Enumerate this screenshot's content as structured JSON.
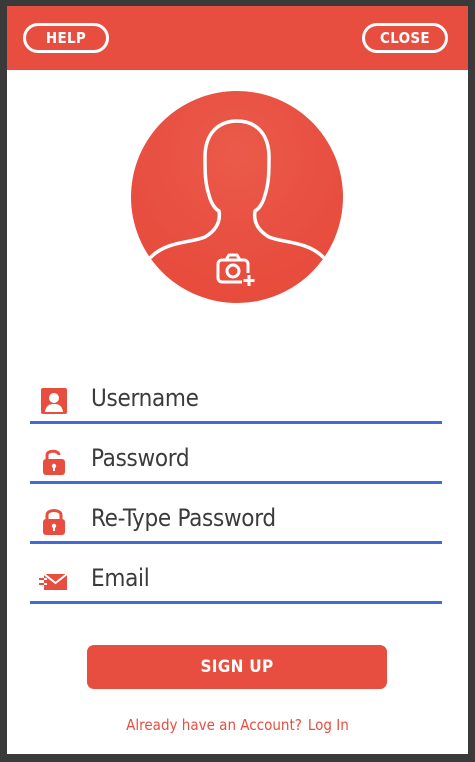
{
  "header": {
    "help_label": "HELP",
    "close_label": "CLOSE"
  },
  "avatar": {
    "icon": "person-silhouette-icon",
    "camera_icon": "camera-add-icon"
  },
  "form": {
    "fields": [
      {
        "icon": "user-icon",
        "placeholder": "Username"
      },
      {
        "icon": "unlock-icon",
        "placeholder": "Password"
      },
      {
        "icon": "lock-icon",
        "placeholder": "Re-Type Password"
      },
      {
        "icon": "email-icon",
        "placeholder": "Email"
      }
    ]
  },
  "signup": {
    "label": "SIGN UP"
  },
  "footer": {
    "prompt": "Already have an Account?",
    "login_link": "Log In"
  },
  "colors": {
    "accent": "#e84e3f",
    "underline": "#4169d8",
    "text": "#3b3b3b",
    "background": "#ffffff"
  }
}
